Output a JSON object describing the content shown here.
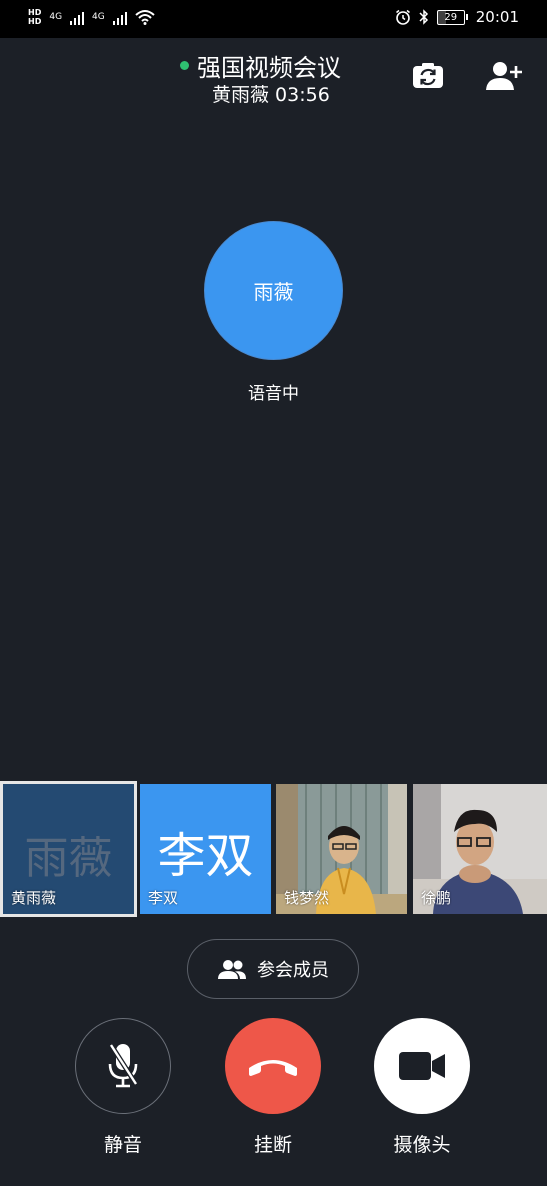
{
  "status_bar": {
    "hd_label_top": "HD",
    "hd_label_bottom": "HD",
    "net1": "4G",
    "net2": "4G",
    "battery_level": "29",
    "time": "20:01"
  },
  "header": {
    "title": "强国视频会议",
    "subtitle": "黄雨薇 03:56",
    "status_dot_color": "#2fbf71",
    "camera_switch_icon": "camera-switch-icon",
    "add_user_icon": "add-user-icon"
  },
  "active_speaker": {
    "avatar_text": "雨薇",
    "status": "语音中",
    "avatar_color": "#3b96f0"
  },
  "participants": [
    {
      "avatar_text": "雨薇",
      "name": "黄雨薇",
      "selected": true
    },
    {
      "avatar_text": "李双",
      "name": "李双"
    },
    {
      "name": "钱梦然",
      "video": true
    },
    {
      "name": "徐鹏",
      "video": true
    }
  ],
  "members_button": {
    "label": "参会成员",
    "icon": "members-icon"
  },
  "controls": {
    "mute": {
      "label": "静音",
      "icon": "mic-off-icon"
    },
    "hangup": {
      "label": "挂断",
      "icon": "phone-hangup-icon",
      "color": "#ee5749"
    },
    "camera": {
      "label": "摄像头",
      "icon": "video-camera-icon"
    }
  }
}
